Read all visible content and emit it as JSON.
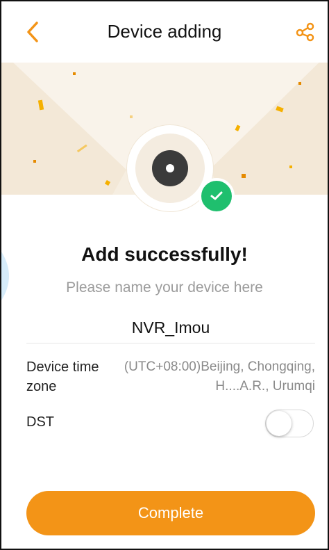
{
  "header": {
    "title": "Device adding",
    "back_icon": "chevron-left-icon",
    "share_icon": "share-icon"
  },
  "colors": {
    "accent": "#f39417",
    "success": "#1fbf6e",
    "hero_bg": "#f6eee1",
    "hint_text": "#9c9c9c"
  },
  "hero": {
    "device_icon": "camera-lens-icon",
    "badge_icon": "check-icon"
  },
  "main": {
    "success_title": "Add successfully!",
    "name_hint": "Please name your device here",
    "device_name": "NVR_Imou"
  },
  "settings": {
    "timezone_label": "Device time zone",
    "timezone_value": "(UTC+08:00)Beijing, Chongqing, H....A.R., Urumqi",
    "dst_label": "DST",
    "dst_enabled": false
  },
  "footer": {
    "complete_label": "Complete"
  }
}
